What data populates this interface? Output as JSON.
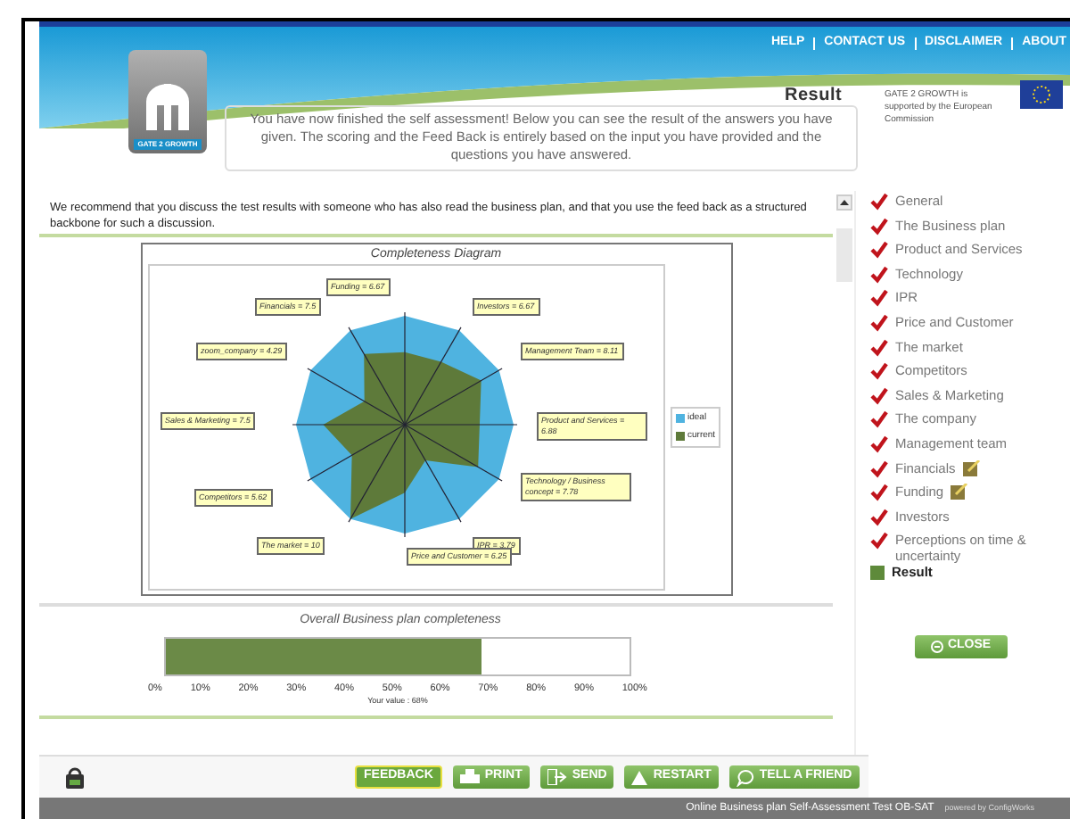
{
  "header": {
    "logo_text": "GATE 2 GROWTH",
    "nav": [
      "HELP",
      "CONTACT US",
      "DISCLAIMER",
      "ABOUT"
    ],
    "page_title": "Result",
    "support_text": "GATE 2 GROWTH is supported by the European Commission"
  },
  "intro": "You have now finished the self assessment! Below you can see the result of the answers you have given. The scoring and the Feed Back is entirely based on the input you have provided and the questions you have answered.",
  "recommendation": "We recommend that you discuss the test results with someone who has also read the business plan, and that you use the feed back as a structured backbone for such a discussion.",
  "diagram": {
    "title": "Completeness Diagram",
    "labels": [
      "Funding = 6.67",
      "Financials = 7.5",
      "Investors = 6.67",
      "zoom_company = 4.29",
      "Management Team = 8.11",
      "Sales & Marketing = 7.5",
      "Product and Services = 6.88",
      "Technology / Business concept = 7.78",
      "Competitors = 5.62",
      "The market = 10",
      "IPR = 3.79",
      "Price and Customer = 6.25"
    ],
    "legend": [
      {
        "name": "ideal",
        "color": "#4fb3e0"
      },
      {
        "name": "current",
        "color": "#5e7a3a"
      }
    ]
  },
  "completeness": {
    "title": "Overall Business plan completeness",
    "level": 0.68,
    "ticks": [
      "0%",
      "10%",
      "20%",
      "30%",
      "40%",
      "50%",
      "60%",
      "70%",
      "80%",
      "90%",
      "100%"
    ],
    "reading": "Your value : 68%"
  },
  "close_button": "CLOSE",
  "sidebar": [
    {
      "label": "General",
      "kind": "check",
      "note": false
    },
    {
      "label": "The Business plan",
      "kind": "check",
      "note": false
    },
    {
      "label": "Product and Services",
      "kind": "check",
      "note": false
    },
    {
      "label": "Technology",
      "kind": "check",
      "note": false
    },
    {
      "label": "IPR",
      "kind": "check",
      "note": false
    },
    {
      "label": "Price and Customer",
      "kind": "check",
      "note": false
    },
    {
      "label": "The market",
      "kind": "check",
      "note": false
    },
    {
      "label": "Competitors",
      "kind": "check",
      "note": false
    },
    {
      "label": "Sales & Marketing",
      "kind": "check",
      "note": false
    },
    {
      "label": "The company",
      "kind": "check",
      "note": false
    },
    {
      "label": "Management team",
      "kind": "check",
      "note": false
    },
    {
      "label": "Financials",
      "kind": "check",
      "note": true
    },
    {
      "label": "Funding",
      "kind": "check",
      "note": true
    },
    {
      "label": "Investors",
      "kind": "check",
      "note": false
    },
    {
      "label": "Perceptions on time & uncertainty",
      "kind": "check",
      "note": false
    },
    {
      "label": "Result",
      "kind": "current",
      "note": false
    }
  ],
  "footer_buttons": [
    {
      "label": "FEEDBACK",
      "kind": "feedback",
      "selected": true
    },
    {
      "label": "PRINT",
      "kind": "print",
      "selected": false
    },
    {
      "label": "SEND",
      "kind": "send",
      "selected": false
    },
    {
      "label": "RESTART",
      "kind": "restart",
      "selected": false
    },
    {
      "label": "TELL A FRIEND",
      "kind": "tell",
      "selected": false
    }
  ],
  "status_bar": {
    "text": "Online Business plan Self-Assessment Test OB-SAT",
    "powered": "powered by ConfigWorks"
  }
}
